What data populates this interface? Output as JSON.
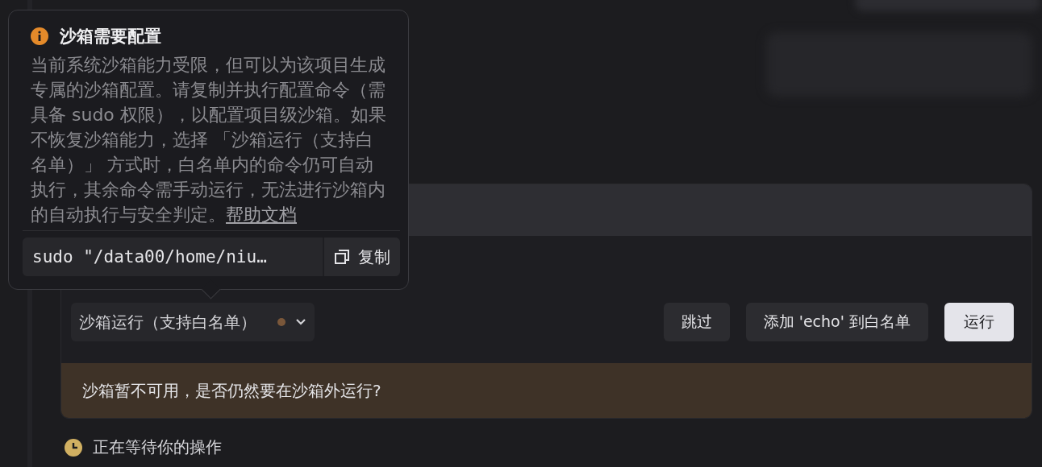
{
  "popover": {
    "title": "沙箱需要配置",
    "body": "当前系统沙箱能力受限，但可以为该项目生成专属的沙箱配置。请复制并执行配置命令（需具备 sudo 权限），以配置项目级沙箱。如果不恢复沙箱能力，选择 「沙箱运行（支持白名单）」 方式时，白名单内的命令仍可自动执行，其余命令需手动运行，无法进行沙箱内的自动执行与安全判定。",
    "link": "帮助文档",
    "command": "sudo \"/data00/home/niu…",
    "copy_label": "复制"
  },
  "mode_select": {
    "value": "沙箱运行（支持白名单）"
  },
  "buttons": [
    {
      "label": "跳过",
      "kind": "secondary"
    },
    {
      "label": "添加 'echo' 到白名单",
      "kind": "secondary"
    },
    {
      "label": "运行",
      "kind": "primary"
    }
  ],
  "warning": "沙箱暂不可用，是否仍然要在沙箱外运行?",
  "status": "正在等待你的操作"
}
